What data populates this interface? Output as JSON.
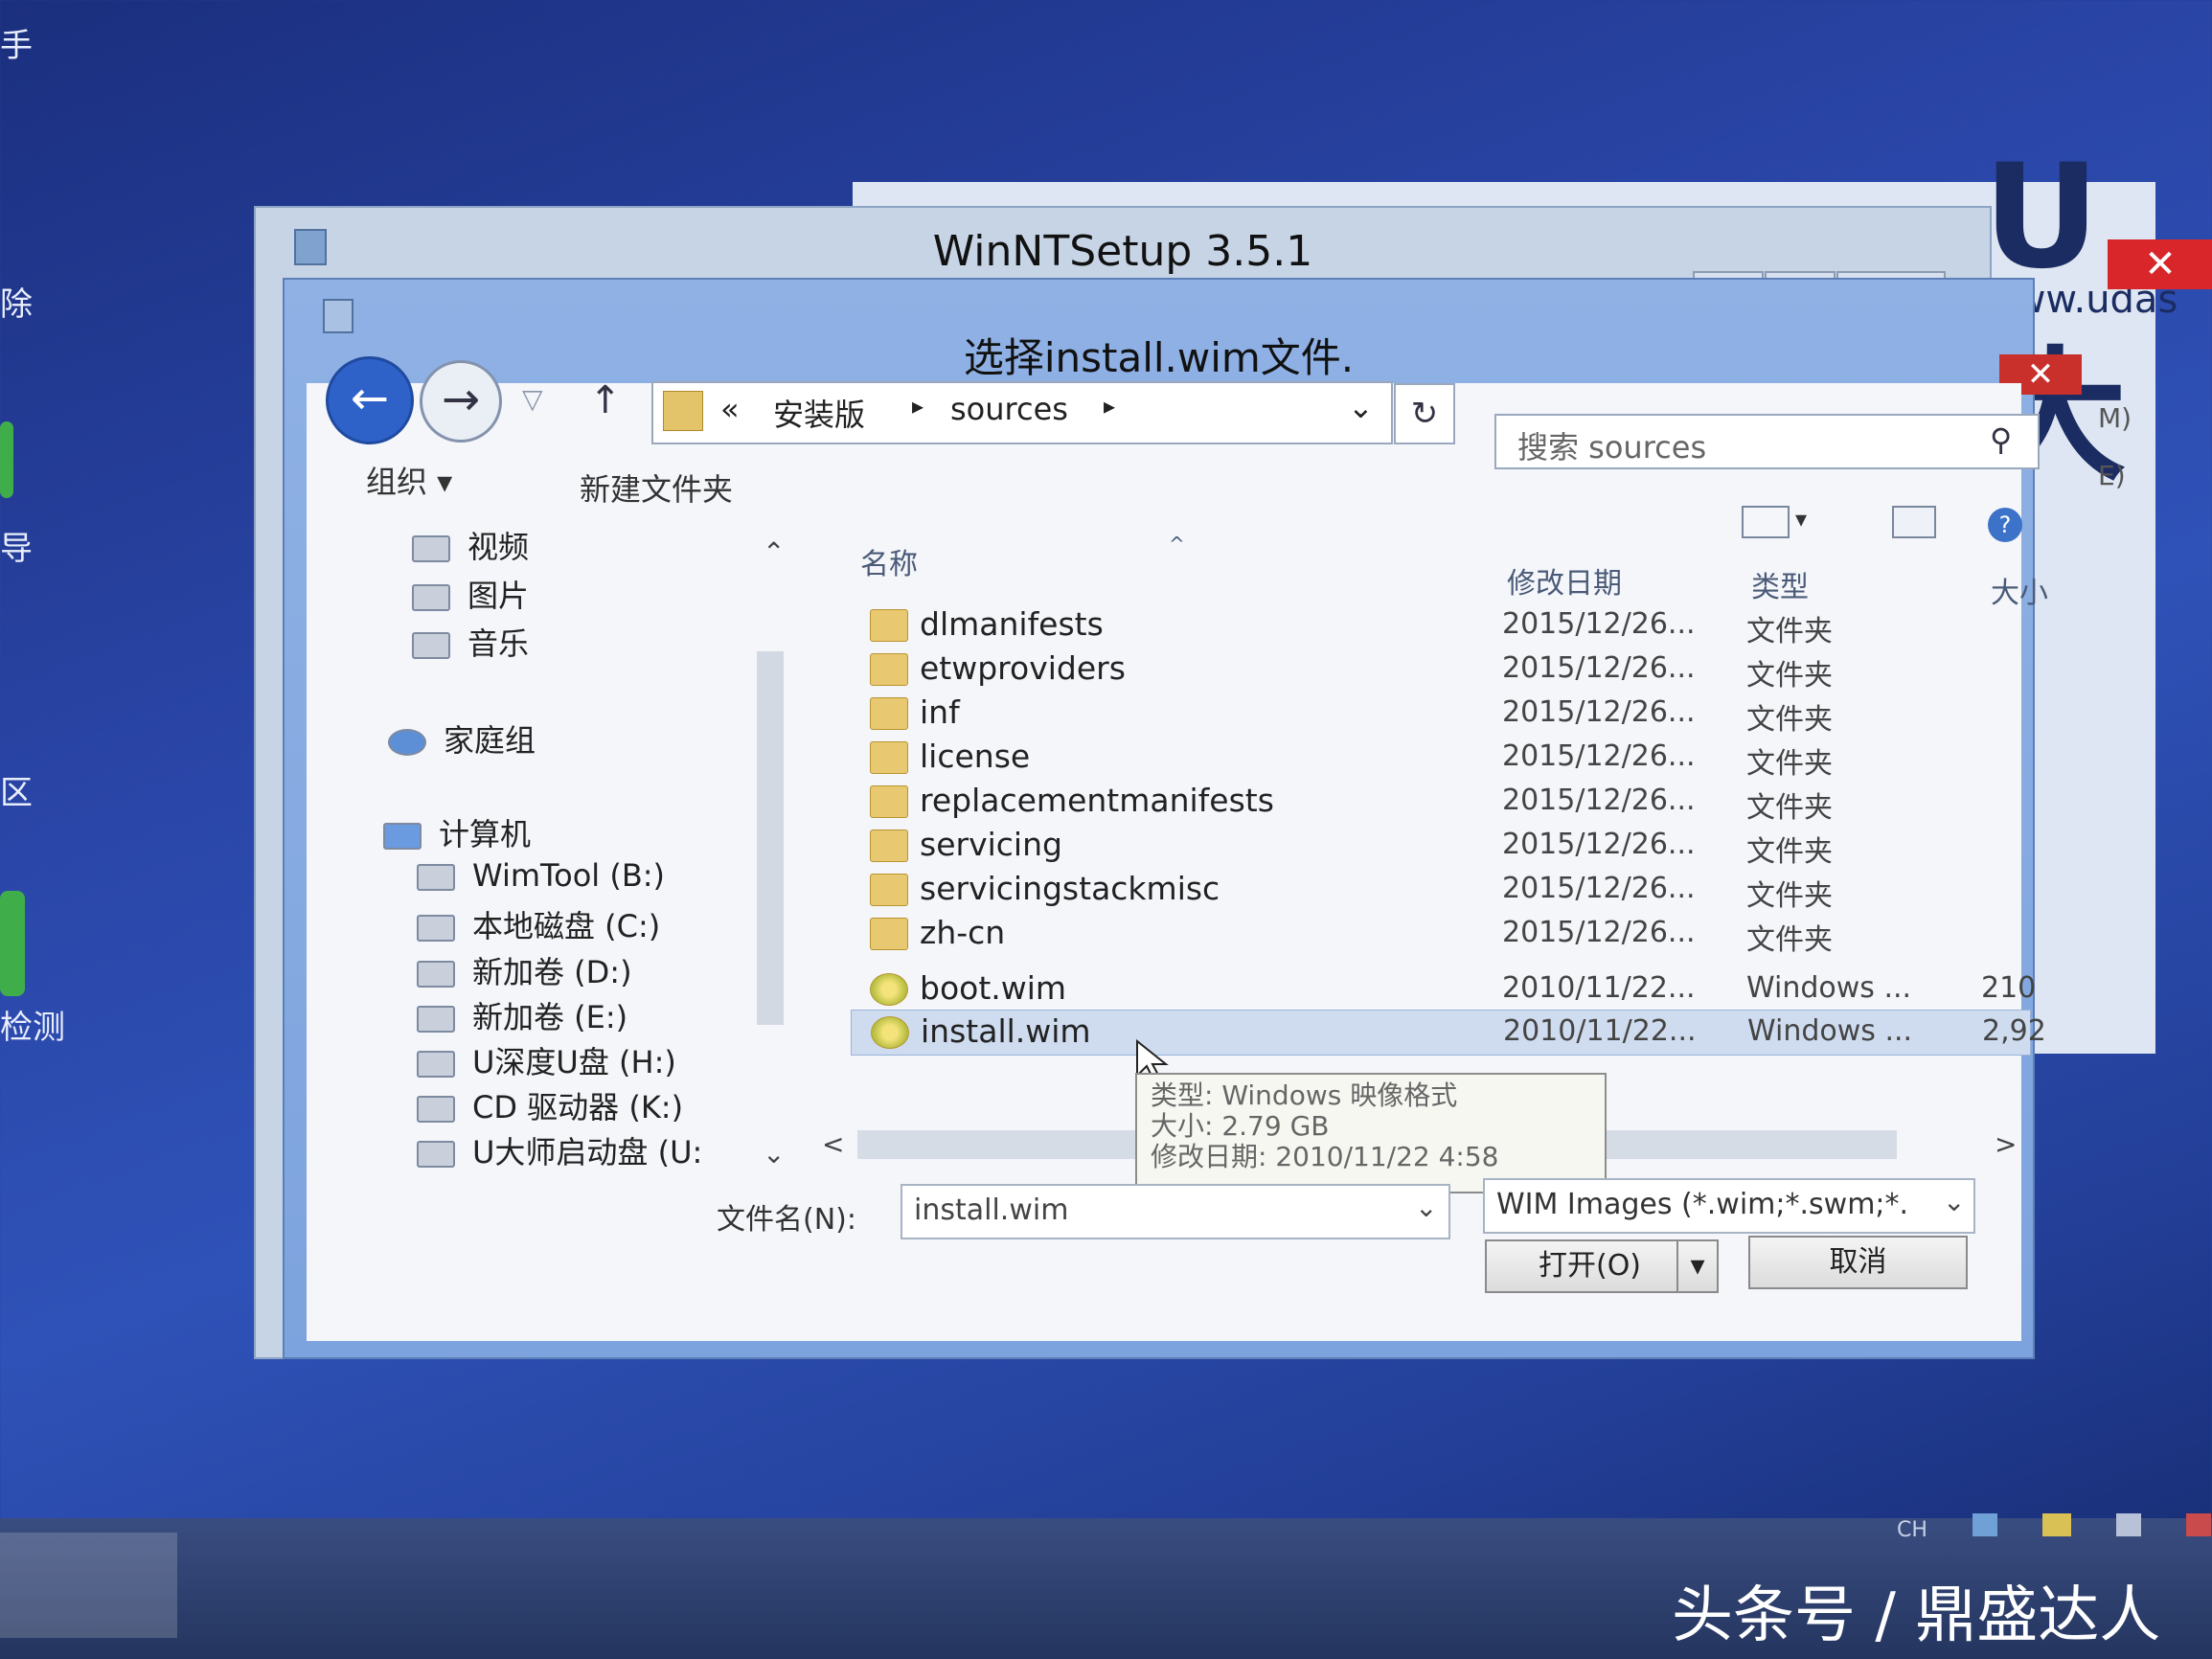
{
  "desktop": {
    "side_labels": [
      "手",
      "除",
      "导",
      "区",
      "检测"
    ],
    "brand_logo": "U大",
    "brand_url": "www.udas"
  },
  "background_window": {
    "close_glyph": "✕",
    "side_fragments": [
      "M)",
      "E)"
    ]
  },
  "winntsetup": {
    "title": "WinNTSetup 3.5.1",
    "minimize": "▭",
    "maximize": "▢",
    "close": "✕"
  },
  "dialog": {
    "title": "选择install.wim文件.",
    "close": "✕",
    "nav": {
      "back_glyph": "←",
      "forward_glyph": "→",
      "dropdown_glyph": "▽",
      "up_glyph": "↑"
    },
    "address": {
      "prefix": "«",
      "crumbs": [
        "安装版",
        "sources"
      ],
      "separator": "▸",
      "dropdown_glyph": "⌄",
      "refresh_glyph": "↻"
    },
    "search": {
      "placeholder": "搜索 sources",
      "icon_glyph": "⚲"
    },
    "toolbar": {
      "organize": "组织 ▾",
      "new_folder": "新建文件夹"
    },
    "left_nav": {
      "libraries": [
        "视频",
        "图片",
        "音乐"
      ],
      "homegroup": "家庭组",
      "computer": "计算机",
      "drives": [
        "WimTool (B:)",
        "本地磁盘 (C:)",
        "新加卷 (D:)",
        "新加卷 (E:)",
        "U深度U盘 (H:)",
        "CD 驱动器 (K:)",
        "U大师启动盘 (U:"
      ]
    },
    "columns": {
      "name": "名称",
      "date": "修改日期",
      "type": "类型",
      "size": "大小"
    },
    "files": [
      {
        "name": "dlmanifests",
        "date": "2015/12/26...",
        "type": "文件夹",
        "size": ""
      },
      {
        "name": "etwproviders",
        "date": "2015/12/26...",
        "type": "文件夹",
        "size": ""
      },
      {
        "name": "inf",
        "date": "2015/12/26...",
        "type": "文件夹",
        "size": ""
      },
      {
        "name": "license",
        "date": "2015/12/26...",
        "type": "文件夹",
        "size": ""
      },
      {
        "name": "replacementmanifests",
        "date": "2015/12/26...",
        "type": "文件夹",
        "size": ""
      },
      {
        "name": "servicing",
        "date": "2015/12/26...",
        "type": "文件夹",
        "size": ""
      },
      {
        "name": "servicingstackmisc",
        "date": "2015/12/26...",
        "type": "文件夹",
        "size": ""
      },
      {
        "name": "zh-cn",
        "date": "2015/12/26...",
        "type": "文件夹",
        "size": ""
      },
      {
        "name": "boot.wim",
        "date": "2010/11/22...",
        "type": "Windows ...",
        "size": "210"
      },
      {
        "name": "install.wim",
        "date": "2010/11/22...",
        "type": "Windows ...",
        "size": "2,92"
      }
    ],
    "tooltip": {
      "type": "类型: Windows 映像格式",
      "size": "大小: 2.79 GB",
      "modified": "修改日期: 2010/11/22 4:58"
    },
    "filename_label": "文件名(N):",
    "filename_value": "install.wim",
    "filetype_value": "WIM Images (*.wim;*.swm;*.",
    "open_button": "打开(O)",
    "cancel_button": "取消",
    "scroll_left": "<",
    "scroll_right": ">"
  },
  "taskbar": {
    "tray_text": "CH"
  },
  "watermark": "头条号 / 鼎盛达人",
  "colors": {
    "desktop_blue": "#2a46a8",
    "dialog_frame": "#7da3de",
    "close_red": "#c9302c",
    "selection": "#cfdcef"
  }
}
